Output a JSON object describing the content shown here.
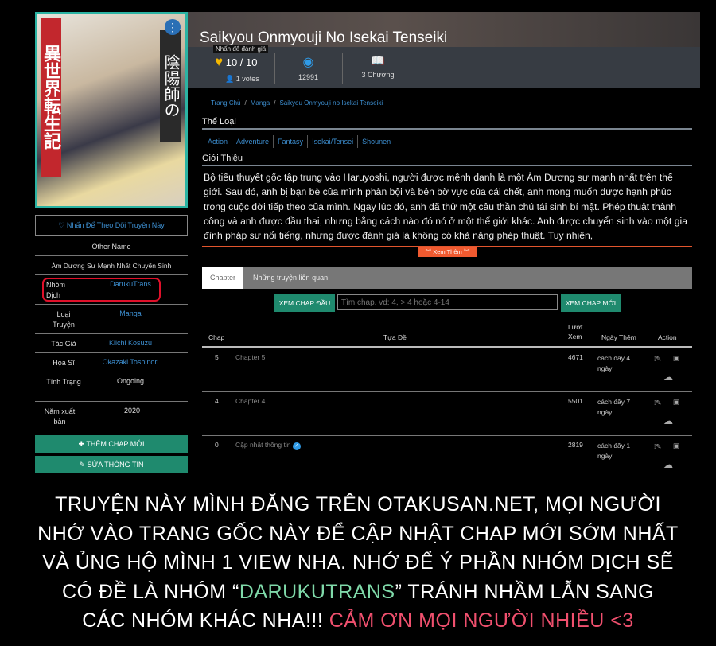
{
  "cover": {
    "lettering_left": "異世界転生記",
    "lettering_right": "陰陽師の",
    "menu_icon": "more-vert-icon"
  },
  "header": {
    "title": "Saikyou Onmyouji No Isekai Tenseiki",
    "tooltip": "Nhấn để đánh giá",
    "rating": "10 / 10",
    "votes": "1 votes",
    "views": "12991",
    "chapters": "3 Chương"
  },
  "sidebar": {
    "follow": "♡ Nhấn Để Theo Dõi Truyện Này",
    "other_name_label": "Other Name",
    "other_name": "Âm Dương Sư Mạnh Nhất Chuyển Sinh",
    "rows": [
      {
        "key": "Nhóm Dịch",
        "value": "DarukuTrans"
      },
      {
        "key": "Loại Truyện",
        "value": "Manga"
      },
      {
        "key": "Tác Giả",
        "value": "Kiichi Kosuzu"
      },
      {
        "key": "Họa Sĩ",
        "value": "Okazaki Toshinori"
      },
      {
        "key": "Tình Trạng",
        "value": "Ongoing"
      },
      {
        "key": "Năm xuất bản",
        "value": "2020"
      }
    ],
    "add_chapter": "✚ THÊM CHAP MỚI",
    "edit_info": "✎ SỬA THÔNG TIN",
    "highlight_color": "#e0102a"
  },
  "breadcrumb": [
    "Trang Chủ",
    "Manga",
    "Saikyou Onmyouji no Isekai Tenseiki"
  ],
  "genres_title": "Thể Loại",
  "genres": [
    "Action",
    "Adventure",
    "Fantasy",
    "Isekai/Tensei",
    "Shounen"
  ],
  "intro_title": "Giới Thiệu",
  "description": "Bộ tiểu thuyết gốc tập trung vào Haruyoshi, người được mệnh danh là một Âm Dương sư mạnh nhất trên thế giới. Sau đó, anh bị bạn bè của mình phản bội và bên bờ vực của cái chết, anh mong muốn được hạnh phúc trong cuộc đời tiếp theo của mình. Ngay lúc đó, anh đã thử một câu thần chú tái sinh bí mật. Phép thuật thành công và anh được đầu thai, nhưng bằng cách nào đó nó ở một thế giới khác. Anh được chuyển sinh vào một gia đình pháp sư nổi tiếng, nhưng được đánh giá là không có khả năng phép thuật. Tuy nhiên,",
  "show_more": "︾ Xem Thêm ︾",
  "tabs": [
    "Chapter",
    "Những truyện liên quan"
  ],
  "first_chap": "XEM CHAP ĐẦU",
  "latest_chap": "XEM CHAP MỚI",
  "search_placeholder": "Tìm chap. vd: 4, > 4 hoặc 4-14",
  "table": {
    "headers": {
      "chap": "Chap",
      "title": "Tựa Đề",
      "views": "Lượt Xem",
      "date": "Ngày Thêm",
      "action": "Action"
    },
    "rows": [
      {
        "chap": "5",
        "title": "Chapter 5",
        "views": "4671",
        "date": "cách đây 4 ngày"
      },
      {
        "chap": "4",
        "title": "Chapter 4",
        "views": "5501",
        "date": "cách đây 7 ngày"
      },
      {
        "chap": "0",
        "title": "Cập nhật thông tin",
        "views": "2819",
        "date": "cách đây 1 ngày",
        "verified": true
      }
    ]
  },
  "notice": {
    "l1": "Truyện này mình đăng trên otakusan.net, mọi người",
    "l2": "nhớ vào trang gốc này để cập nhật chap mới sớm nhất",
    "l3": "và ủng hộ mình 1 view nha. Nhớ để ý phần nhóm dịch sẽ",
    "l4a": "có đề là nhóm “",
    "l4b": "DarukuTrans",
    "l4c": "” tránh nhầm lẫn sang",
    "l5a": "các nhóm khác nha!!! ",
    "l5b": "Cảm ơn mọi người nhiều <3"
  },
  "colors": {
    "accent_green": "#1f8a6e",
    "link": "#3d8fd1",
    "highlight_green": "#7fd9a9",
    "highlight_pink": "#f0506e",
    "show_more": "#f05a30"
  }
}
